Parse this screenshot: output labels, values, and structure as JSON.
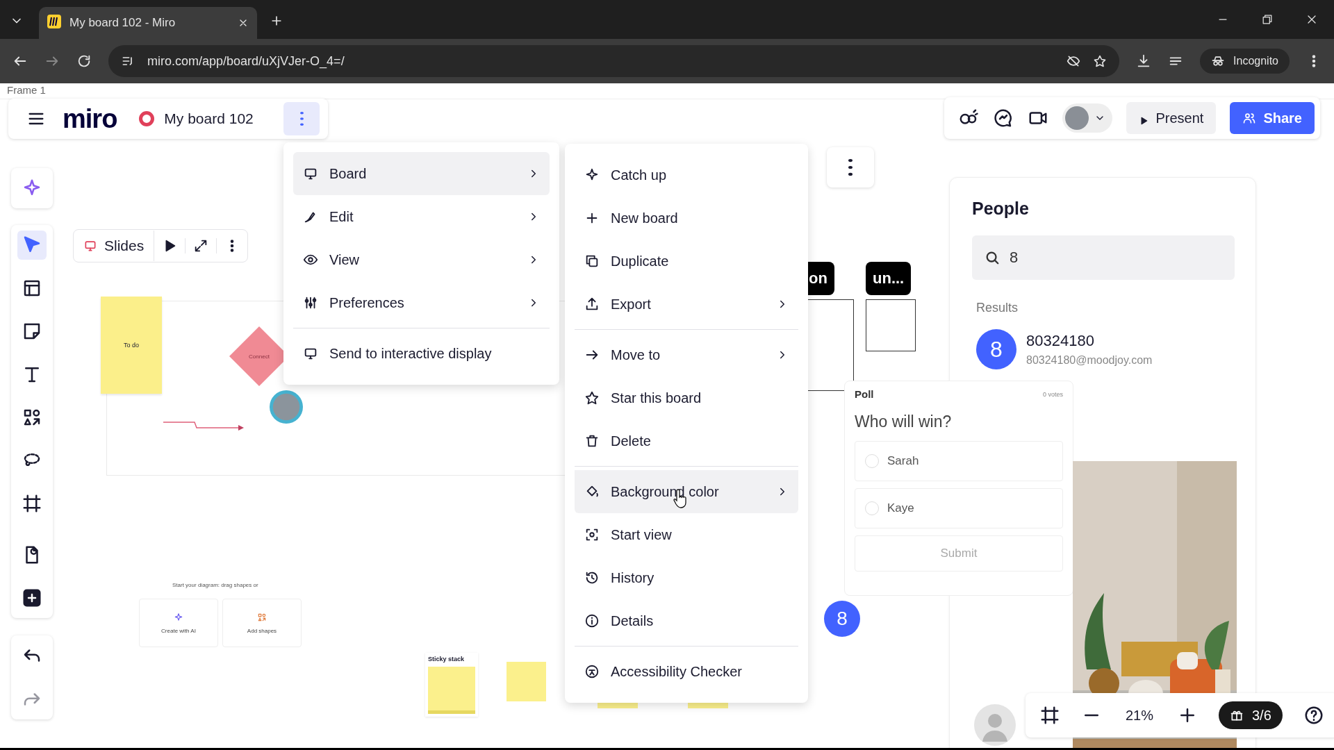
{
  "browser": {
    "tab_title": "My board 102 - Miro",
    "url": "miro.com/app/board/uXjVJer-O_4=/",
    "profile_label": "Incognito"
  },
  "frame_label": "Frame 1",
  "header": {
    "logo": "miro",
    "board_name": "My board 102"
  },
  "top_right": {
    "present": "Present",
    "share": "Share"
  },
  "tools": [
    {
      "kind": "ai",
      "selected": false
    },
    {
      "kind": "select",
      "selected": true
    },
    {
      "kind": "templates",
      "selected": false
    },
    {
      "kind": "sticky",
      "selected": false
    },
    {
      "kind": "text",
      "selected": false
    },
    {
      "kind": "shapes",
      "selected": false
    },
    {
      "kind": "lasso",
      "selected": false
    },
    {
      "kind": "frame",
      "selected": false
    },
    {
      "kind": "upload",
      "selected": false
    },
    {
      "kind": "more",
      "selected": false
    }
  ],
  "slides_bar": {
    "label": "Slides"
  },
  "board_menu": [
    {
      "label": "Board",
      "submenu": true,
      "selected": true,
      "divider_before": false
    },
    {
      "label": "Edit",
      "submenu": true,
      "selected": false,
      "divider_before": false
    },
    {
      "label": "View",
      "submenu": true,
      "selected": false,
      "divider_before": false
    },
    {
      "label": "Preferences",
      "submenu": true,
      "selected": false,
      "divider_before": false
    },
    {
      "label": "Send to interactive display",
      "submenu": false,
      "selected": false,
      "divider_before": true
    }
  ],
  "board_submenu": [
    {
      "label": "Catch up",
      "submenu": false,
      "selected": false,
      "divider_before": false
    },
    {
      "label": "New board",
      "submenu": false,
      "selected": false,
      "divider_before": false
    },
    {
      "label": "Duplicate",
      "submenu": false,
      "selected": false,
      "divider_before": false
    },
    {
      "label": "Export",
      "submenu": true,
      "selected": false,
      "divider_before": false
    },
    {
      "label": "Move to",
      "submenu": true,
      "selected": false,
      "divider_before": true
    },
    {
      "label": "Star this board",
      "submenu": false,
      "selected": false,
      "divider_before": false
    },
    {
      "label": "Delete",
      "submenu": false,
      "selected": false,
      "divider_before": false
    },
    {
      "label": "Background color",
      "submenu": true,
      "selected": true,
      "divider_before": true
    },
    {
      "label": "Start view",
      "submenu": false,
      "selected": false,
      "divider_before": false
    },
    {
      "label": "History",
      "submenu": false,
      "selected": false,
      "divider_before": false
    },
    {
      "label": "Details",
      "submenu": false,
      "selected": false,
      "divider_before": false
    },
    {
      "label": "Accessibility Checker",
      "submenu": false,
      "selected": false,
      "divider_before": true
    }
  ],
  "canvas": {
    "sticky_note": "To do",
    "shape": "Connect",
    "diagram_prompt": "Start your diagram: drag shapes or",
    "prompt_buttons": [
      "Create with AI",
      "Add shapes"
    ],
    "sticky_stack": "Sticky stack",
    "tags": [
      "on",
      "un..."
    ],
    "cursor_badge": "8"
  },
  "people": {
    "title": "People",
    "search_value": "8",
    "results_label": "Results",
    "results": [
      {
        "initial": "8",
        "name": "80324180",
        "email": "80324180@moodjoy.com"
      }
    ]
  },
  "poll": {
    "title": "Poll",
    "votes": "0 votes",
    "question": "Who will win?",
    "options": [
      {
        "label": "Sarah",
        "selected": false
      },
      {
        "label": "Kaye",
        "selected": false
      }
    ],
    "submit": "Submit"
  },
  "zoom": {
    "level": "21%",
    "gift": "3/6"
  }
}
